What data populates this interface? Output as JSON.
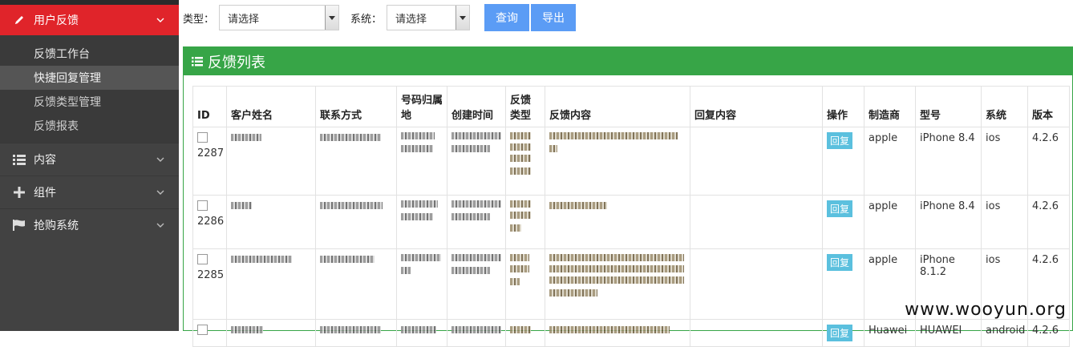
{
  "sidebar": {
    "active_group": "用户反馈",
    "sub_items": [
      "反馈工作台",
      "快捷回复管理",
      "反馈类型管理",
      "反馈报表"
    ],
    "groups": [
      {
        "label": "内容",
        "icon": "list-icon"
      },
      {
        "label": "组件",
        "icon": "plus-icon"
      },
      {
        "label": "抢购系统",
        "icon": "flag-icon"
      }
    ]
  },
  "filter": {
    "type_label": "类型：",
    "type_value": "请选择",
    "system_label": "系统：",
    "system_value": "请选择",
    "query_button": "查询",
    "export_button": "导出"
  },
  "panel": {
    "title": "反馈列表"
  },
  "table": {
    "headers": [
      "ID",
      "客户姓名",
      "联系方式",
      "号码归属地",
      "创建时间",
      "反馈类型",
      "反馈内容",
      "回复内容",
      "操作",
      "制造商",
      "型号",
      "系统",
      "版本"
    ],
    "rows": [
      {
        "id": "2287",
        "action": "回复",
        "maker": "apple",
        "model": "iPhone 8.4",
        "os": "ios",
        "version": "4.2.6"
      },
      {
        "id": "2286",
        "action": "回复",
        "maker": "apple",
        "model": "iPhone 8.4",
        "os": "ios",
        "version": "4.2.6"
      },
      {
        "id": "2285",
        "action": "回复",
        "maker": "apple",
        "model": "iPhone 8.1.2",
        "os": "ios",
        "version": "4.2.6"
      },
      {
        "id": "",
        "action": "回复",
        "maker": "Huawei",
        "model": "HUAWEI",
        "os": "android",
        "version": "4.2.6"
      }
    ]
  },
  "watermark": "www.wooyun.org"
}
